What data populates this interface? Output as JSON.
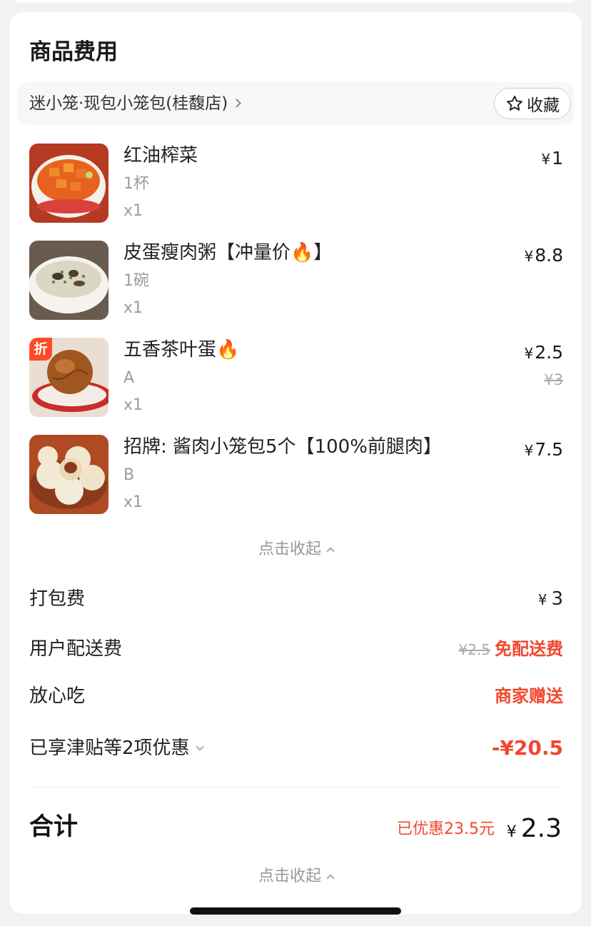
{
  "section_title": "商品费用",
  "store": {
    "name": "迷小笼·现包小笼包(桂馥店)",
    "favorite_label": "收藏"
  },
  "items": [
    {
      "name": "红油榨菜",
      "spec": "1杯",
      "qty": "x1",
      "price": "1",
      "original_price": "",
      "discount_tag": ""
    },
    {
      "name": "皮蛋瘦肉粥【冲量价🔥】",
      "spec": "1碗",
      "qty": "x1",
      "price": "8.8",
      "original_price": "",
      "discount_tag": ""
    },
    {
      "name": "五香茶叶蛋🔥",
      "spec": "A",
      "qty": "x1",
      "price": "2.5",
      "original_price": "¥3",
      "discount_tag": "折"
    },
    {
      "name": "招牌: 酱肉小笼包5个【100%前腿肉】",
      "spec": "B",
      "qty": "x1",
      "price": "7.5",
      "original_price": "",
      "discount_tag": ""
    }
  ],
  "currency": "¥",
  "collapse_label": "点击收起",
  "fees": {
    "packing": {
      "label": "打包费",
      "value": "3"
    },
    "delivery": {
      "label": "用户配送费",
      "original": "¥2.5",
      "value": "免配送费"
    },
    "assurance": {
      "label": "放心吃",
      "value": "商家赠送"
    },
    "discounts": {
      "label": "已享津贴等2项优惠",
      "value": "-¥20.5"
    }
  },
  "total": {
    "label": "合计",
    "saved": "已优惠23.5元",
    "value": "2.3"
  },
  "colors": {
    "accent_red": "#f2472e",
    "discount_tag": "#ff4a26"
  }
}
